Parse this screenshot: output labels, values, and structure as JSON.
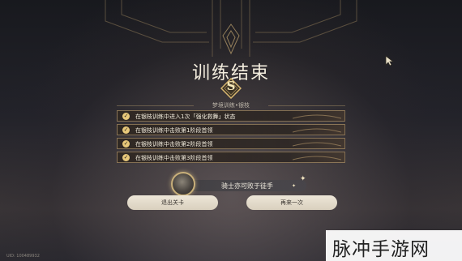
{
  "screen": {
    "title": "训练结束",
    "rank": "S",
    "subtitle": "梦境训练•银枝",
    "goals": [
      "在银枝训练中进入1次「强化救舞」状态",
      "在银枝训练中击败第1阶段首领",
      "在银枝训练中击败第2阶段首领",
      "在银枝训练中击败第3阶段首领"
    ],
    "card_text": "骑士亦可败于徒手",
    "buttons": {
      "exit": "退出关卡",
      "retry": "再来一次"
    },
    "uid": "UID: 100489932"
  },
  "watermark": "脉冲手游网",
  "colors": {
    "accent_gold": "#e8c87a",
    "button_bg": "#ede6d8",
    "text_light": "#f4eedf"
  },
  "icons": {
    "check": "check-circle-icon",
    "rank": "rank-badge-icon",
    "medal": "medal-icon",
    "cursor": "mouse-cursor-icon"
  }
}
